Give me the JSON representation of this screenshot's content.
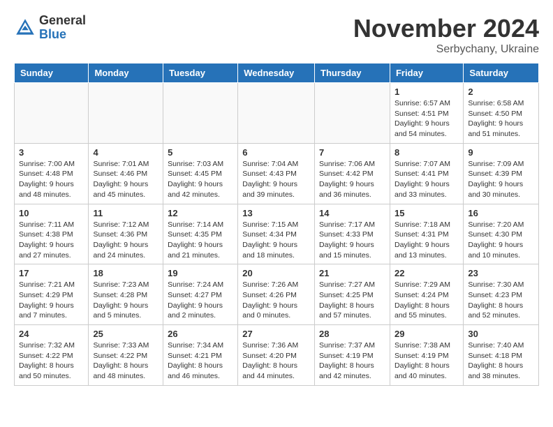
{
  "header": {
    "logo_general": "General",
    "logo_blue": "Blue",
    "month_title": "November 2024",
    "location": "Serbychany, Ukraine"
  },
  "weekdays": [
    "Sunday",
    "Monday",
    "Tuesday",
    "Wednesday",
    "Thursday",
    "Friday",
    "Saturday"
  ],
  "weeks": [
    [
      {
        "day": "",
        "info": ""
      },
      {
        "day": "",
        "info": ""
      },
      {
        "day": "",
        "info": ""
      },
      {
        "day": "",
        "info": ""
      },
      {
        "day": "",
        "info": ""
      },
      {
        "day": "1",
        "info": "Sunrise: 6:57 AM\nSunset: 4:51 PM\nDaylight: 9 hours\nand 54 minutes."
      },
      {
        "day": "2",
        "info": "Sunrise: 6:58 AM\nSunset: 4:50 PM\nDaylight: 9 hours\nand 51 minutes."
      }
    ],
    [
      {
        "day": "3",
        "info": "Sunrise: 7:00 AM\nSunset: 4:48 PM\nDaylight: 9 hours\nand 48 minutes."
      },
      {
        "day": "4",
        "info": "Sunrise: 7:01 AM\nSunset: 4:46 PM\nDaylight: 9 hours\nand 45 minutes."
      },
      {
        "day": "5",
        "info": "Sunrise: 7:03 AM\nSunset: 4:45 PM\nDaylight: 9 hours\nand 42 minutes."
      },
      {
        "day": "6",
        "info": "Sunrise: 7:04 AM\nSunset: 4:43 PM\nDaylight: 9 hours\nand 39 minutes."
      },
      {
        "day": "7",
        "info": "Sunrise: 7:06 AM\nSunset: 4:42 PM\nDaylight: 9 hours\nand 36 minutes."
      },
      {
        "day": "8",
        "info": "Sunrise: 7:07 AM\nSunset: 4:41 PM\nDaylight: 9 hours\nand 33 minutes."
      },
      {
        "day": "9",
        "info": "Sunrise: 7:09 AM\nSunset: 4:39 PM\nDaylight: 9 hours\nand 30 minutes."
      }
    ],
    [
      {
        "day": "10",
        "info": "Sunrise: 7:11 AM\nSunset: 4:38 PM\nDaylight: 9 hours\nand 27 minutes."
      },
      {
        "day": "11",
        "info": "Sunrise: 7:12 AM\nSunset: 4:36 PM\nDaylight: 9 hours\nand 24 minutes."
      },
      {
        "day": "12",
        "info": "Sunrise: 7:14 AM\nSunset: 4:35 PM\nDaylight: 9 hours\nand 21 minutes."
      },
      {
        "day": "13",
        "info": "Sunrise: 7:15 AM\nSunset: 4:34 PM\nDaylight: 9 hours\nand 18 minutes."
      },
      {
        "day": "14",
        "info": "Sunrise: 7:17 AM\nSunset: 4:33 PM\nDaylight: 9 hours\nand 15 minutes."
      },
      {
        "day": "15",
        "info": "Sunrise: 7:18 AM\nSunset: 4:31 PM\nDaylight: 9 hours\nand 13 minutes."
      },
      {
        "day": "16",
        "info": "Sunrise: 7:20 AM\nSunset: 4:30 PM\nDaylight: 9 hours\nand 10 minutes."
      }
    ],
    [
      {
        "day": "17",
        "info": "Sunrise: 7:21 AM\nSunset: 4:29 PM\nDaylight: 9 hours\nand 7 minutes."
      },
      {
        "day": "18",
        "info": "Sunrise: 7:23 AM\nSunset: 4:28 PM\nDaylight: 9 hours\nand 5 minutes."
      },
      {
        "day": "19",
        "info": "Sunrise: 7:24 AM\nSunset: 4:27 PM\nDaylight: 9 hours\nand 2 minutes."
      },
      {
        "day": "20",
        "info": "Sunrise: 7:26 AM\nSunset: 4:26 PM\nDaylight: 9 hours\nand 0 minutes."
      },
      {
        "day": "21",
        "info": "Sunrise: 7:27 AM\nSunset: 4:25 PM\nDaylight: 8 hours\nand 57 minutes."
      },
      {
        "day": "22",
        "info": "Sunrise: 7:29 AM\nSunset: 4:24 PM\nDaylight: 8 hours\nand 55 minutes."
      },
      {
        "day": "23",
        "info": "Sunrise: 7:30 AM\nSunset: 4:23 PM\nDaylight: 8 hours\nand 52 minutes."
      }
    ],
    [
      {
        "day": "24",
        "info": "Sunrise: 7:32 AM\nSunset: 4:22 PM\nDaylight: 8 hours\nand 50 minutes."
      },
      {
        "day": "25",
        "info": "Sunrise: 7:33 AM\nSunset: 4:22 PM\nDaylight: 8 hours\nand 48 minutes."
      },
      {
        "day": "26",
        "info": "Sunrise: 7:34 AM\nSunset: 4:21 PM\nDaylight: 8 hours\nand 46 minutes."
      },
      {
        "day": "27",
        "info": "Sunrise: 7:36 AM\nSunset: 4:20 PM\nDaylight: 8 hours\nand 44 minutes."
      },
      {
        "day": "28",
        "info": "Sunrise: 7:37 AM\nSunset: 4:19 PM\nDaylight: 8 hours\nand 42 minutes."
      },
      {
        "day": "29",
        "info": "Sunrise: 7:38 AM\nSunset: 4:19 PM\nDaylight: 8 hours\nand 40 minutes."
      },
      {
        "day": "30",
        "info": "Sunrise: 7:40 AM\nSunset: 4:18 PM\nDaylight: 8 hours\nand 38 minutes."
      }
    ]
  ]
}
